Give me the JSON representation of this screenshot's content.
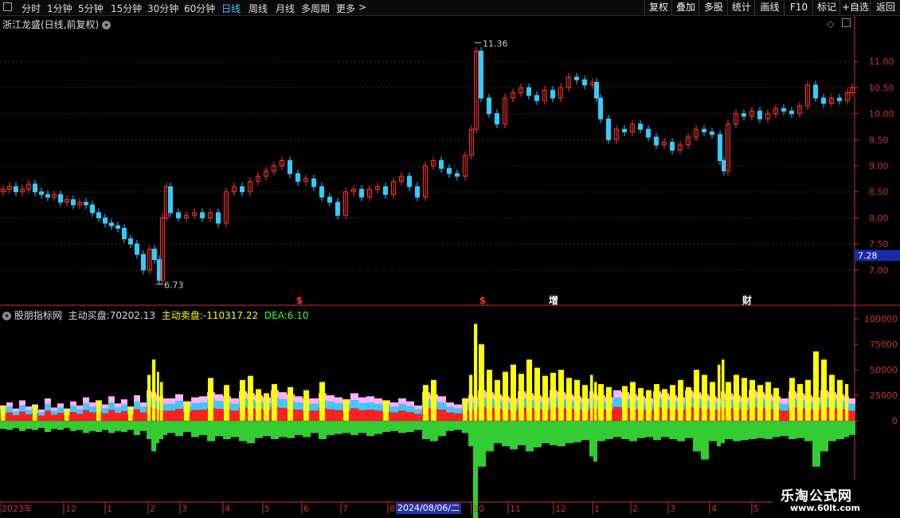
{
  "toolbar": {
    "periods": [
      {
        "label": "分时",
        "active": false
      },
      {
        "label": "1分钟",
        "active": false
      },
      {
        "label": "5分钟",
        "active": false
      },
      {
        "label": "15分钟",
        "active": false
      },
      {
        "label": "30分钟",
        "active": false
      },
      {
        "label": "60分钟",
        "active": false
      },
      {
        "label": "日线",
        "active": true
      },
      {
        "label": "周线",
        "active": false
      },
      {
        "label": "月线",
        "active": false
      },
      {
        "label": "多周期",
        "active": false
      },
      {
        "label": "更多",
        "active": false
      }
    ],
    "more_chevron": ">",
    "actions": [
      "复权",
      "叠加",
      "多股",
      "统计",
      "画线",
      "F10",
      "标记",
      "+自选",
      "返回"
    ]
  },
  "price_panel": {
    "title": "浙江龙盛(日线,前复权)",
    "high_label": "11.36",
    "low_label": "6.73",
    "current_price": "7.28",
    "events": [
      {
        "label": "$",
        "color": "#ff3030"
      },
      {
        "label": "$",
        "color": "#ff3030"
      },
      {
        "label": "增",
        "color": "#ffffff"
      },
      {
        "label": "财",
        "color": "#ffffff"
      }
    ],
    "axis_ticks": [
      "11.00",
      "10.50",
      "10.00",
      "9.50",
      "9.00",
      "8.50",
      "8.00",
      "7.50",
      "7.00"
    ]
  },
  "indicator_panel": {
    "name": "股朋指标网",
    "buy_label": "主动买盘:",
    "buy_value": "70202.13",
    "sell_label": "主动卖盘:",
    "sell_value": "-110317.22",
    "dea_label": "DEA:",
    "dea_value": "6.10",
    "axis_ticks": [
      "100000",
      "75000",
      "50000",
      "25000",
      "0"
    ]
  },
  "time_axis": {
    "labels": [
      "2023年",
      "12",
      "1",
      "2",
      "3",
      "4",
      "5",
      "6",
      "7",
      "8",
      "10",
      "11",
      "12",
      "1",
      "2",
      "3",
      "4",
      "5"
    ],
    "cursor_date": "2024/08/06/二"
  },
  "watermark": {
    "title": "乐淘公式网",
    "url": "www.60lt.com"
  },
  "colors": {
    "up": "#ff3333",
    "down": "#33ccff",
    "volume_yellow": "#ffff00",
    "volume_red": "#ff2020",
    "volume_blue": "#3fc7ff",
    "volume_pink": "#ffb0ff",
    "volume_green": "#33cc33",
    "axis": "#cc3333"
  },
  "chart_data": [
    {
      "type": "candlestick",
      "title": "浙江龙盛(日线,前复权)",
      "ylim": [
        6.6,
        11.6
      ],
      "x": [
        0,
        8,
        16,
        24,
        32,
        40,
        48,
        56,
        64,
        72,
        80,
        88,
        96,
        104,
        112,
        120,
        128,
        136,
        144,
        152,
        160,
        168,
        176,
        184,
        190,
        196,
        200,
        205,
        210,
        220,
        230,
        240,
        250,
        260,
        270,
        280,
        290,
        300,
        310,
        320,
        330,
        340,
        350,
        360,
        370,
        380,
        390,
        400,
        410,
        420,
        430,
        440,
        450,
        460,
        470,
        480,
        490,
        500,
        510,
        520,
        530,
        540,
        550,
        560,
        570,
        580,
        588,
        594,
        600,
        610,
        620,
        630,
        640,
        650,
        660,
        670,
        680,
        690,
        700,
        710,
        720,
        730,
        740,
        745,
        750,
        760,
        770,
        780,
        790,
        800,
        810,
        820,
        830,
        840,
        850,
        860,
        870,
        880,
        890,
        900,
        905,
        910,
        920,
        930,
        940,
        950,
        960,
        970,
        980,
        990,
        1000,
        1010,
        1020,
        1030,
        1040,
        1050,
        1060,
        1066
      ],
      "close": [
        8.55,
        8.6,
        8.5,
        8.55,
        8.65,
        8.5,
        8.45,
        8.4,
        8.45,
        8.3,
        8.35,
        8.25,
        8.3,
        8.25,
        8.1,
        8.0,
        7.9,
        7.85,
        7.8,
        7.6,
        7.5,
        7.3,
        7.0,
        7.4,
        7.2,
        6.8,
        8.0,
        8.6,
        8.1,
        8.0,
        8.05,
        8.1,
        8.0,
        8.1,
        7.9,
        8.5,
        8.6,
        8.5,
        8.7,
        8.8,
        8.9,
        9.0,
        9.1,
        8.85,
        8.7,
        8.75,
        8.6,
        8.4,
        8.3,
        8.05,
        8.5,
        8.55,
        8.4,
        8.55,
        8.6,
        8.45,
        8.7,
        8.8,
        8.6,
        8.4,
        9.0,
        9.1,
        8.95,
        8.85,
        8.8,
        9.2,
        9.7,
        11.2,
        10.3,
        10.0,
        9.8,
        10.3,
        10.4,
        10.5,
        10.35,
        10.25,
        10.45,
        10.3,
        10.5,
        10.7,
        10.65,
        10.55,
        10.6,
        10.3,
        9.9,
        9.5,
        9.7,
        9.65,
        9.8,
        9.7,
        9.55,
        9.4,
        9.45,
        9.3,
        9.4,
        9.55,
        9.7,
        9.65,
        9.6,
        9.1,
        8.9,
        9.8,
        10.0,
        9.95,
        10.05,
        9.9,
        10.0,
        10.1,
        10.05,
        10.0,
        10.15,
        10.55,
        10.3,
        10.2,
        10.3,
        10.25,
        10.4,
        10.5
      ],
      "high_marker": 11.36,
      "low_marker": 6.73
    },
    {
      "type": "bar",
      "title": "股朋指标网",
      "ylim": [
        -150000,
        110000
      ],
      "series": [
        {
          "name": "主动买盘",
          "values": [
            15000,
            18000,
            12000,
            20000,
            14000,
            16000,
            11000,
            22000,
            13000,
            17000,
            12000,
            19000,
            15000,
            25000,
            18000,
            20000,
            16000,
            24000,
            17000,
            21000,
            14000,
            28000,
            18000,
            45000,
            60000,
            48000,
            38000,
            25000,
            22000,
            26000,
            19000,
            30000,
            24000,
            42000,
            28000,
            35000,
            30000,
            40000,
            44000,
            31000,
            27000,
            36000,
            29000,
            33000,
            25000,
            30000,
            22000,
            38000,
            26000,
            24000,
            21000,
            27000,
            23000,
            29000,
            25000,
            20000,
            18000,
            22000,
            19000,
            15000,
            35000,
            40000,
            28000,
            18000,
            16000,
            22000,
            45000,
            95000,
            75000,
            50000,
            40000,
            48000,
            55000,
            46000,
            60000,
            52000,
            44000,
            47000,
            50000,
            42000,
            40000,
            35000,
            45000,
            38000,
            36000,
            33000,
            30000,
            34000,
            38000,
            32000,
            30000,
            36000,
            31000,
            35000,
            40000,
            33000,
            50000,
            45000,
            38000,
            55000,
            60000,
            38000,
            45000,
            42000,
            40000,
            35000,
            38000,
            32000,
            30000,
            42000,
            36000,
            40000,
            68000,
            60000,
            45000,
            40000,
            36000,
            30000
          ]
        },
        {
          "name": "主动卖盘",
          "values": [
            -8000,
            -9000,
            -7000,
            -10000,
            -8000,
            -9000,
            -7000,
            -11000,
            -8000,
            -9000,
            -7000,
            -10000,
            -9000,
            -12000,
            -10000,
            -11000,
            -9000,
            -12000,
            -10000,
            -11000,
            -9000,
            -14000,
            -10000,
            -18000,
            -30000,
            -22000,
            -18000,
            -14000,
            -12000,
            -15000,
            -11000,
            -16000,
            -14000,
            -20000,
            -15000,
            -18000,
            -16000,
            -20000,
            -22000,
            -17000,
            -15000,
            -18000,
            -16000,
            -17000,
            -14000,
            -16000,
            -12000,
            -18000,
            -14000,
            -13000,
            -12000,
            -14000,
            -12000,
            -15000,
            -13000,
            -11000,
            -10000,
            -12000,
            -11000,
            -9000,
            -18000,
            -20000,
            -15000,
            -10000,
            -9000,
            -12000,
            -25000,
            -110317,
            -45000,
            -30000,
            -22000,
            -25000,
            -28000,
            -24000,
            -30000,
            -26000,
            -22000,
            -24000,
            -25000,
            -22000,
            -21000,
            -19000,
            -35000,
            -40000,
            -20000,
            -18000,
            -16000,
            -18000,
            -20000,
            -17000,
            -16000,
            -19000,
            -16000,
            -18000,
            -20000,
            -17000,
            -30000,
            -38000,
            -20000,
            -25000,
            -22000,
            -18000,
            -20000,
            -19000,
            -18000,
            -17000,
            -18000,
            -16000,
            -15000,
            -18000,
            -17000,
            -20000,
            -45000,
            -30000,
            -20000,
            -18000,
            -16000,
            -14000
          ]
        }
      ],
      "dea": 6.1
    }
  ]
}
